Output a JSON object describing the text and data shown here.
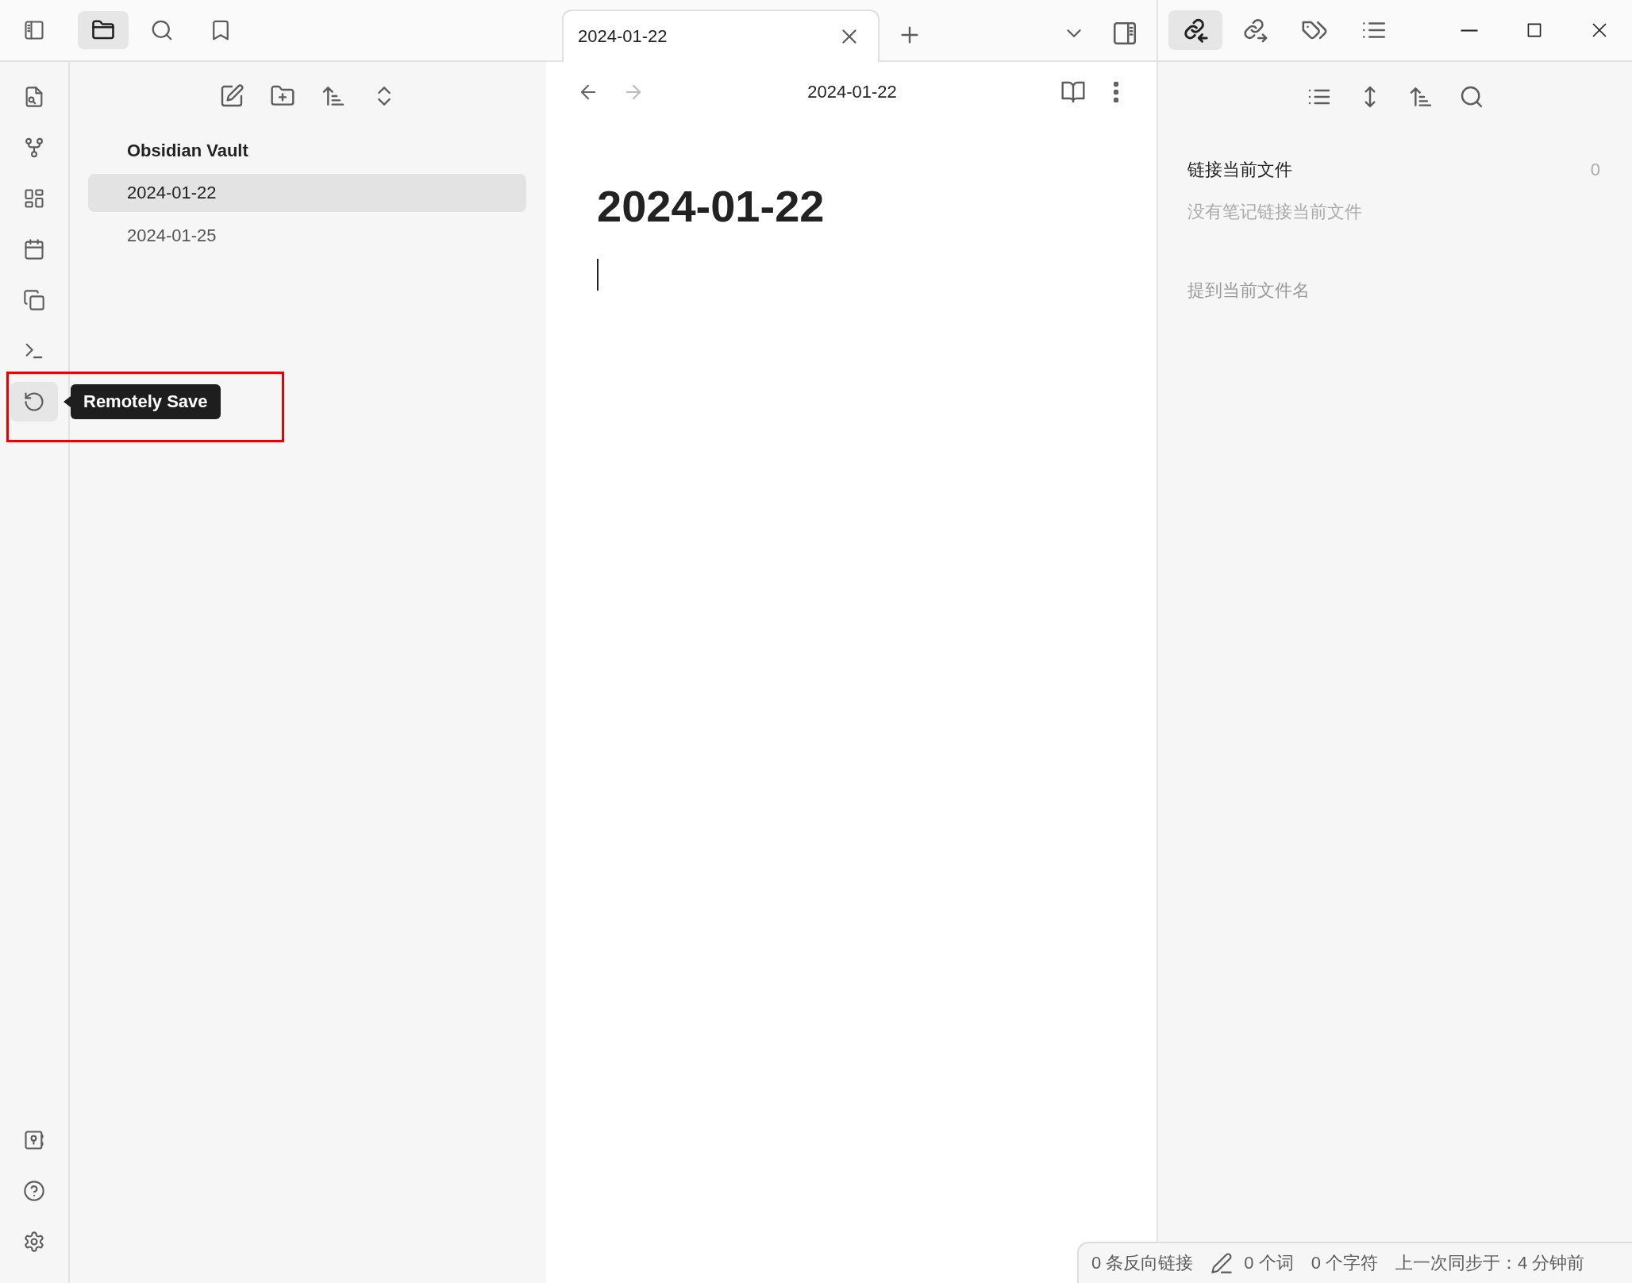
{
  "sidebar_tabs": [
    {
      "selected": true
    },
    {
      "selected": false
    },
    {
      "selected": false
    }
  ],
  "ribbon": {
    "top": [
      {
        "hovered": false
      },
      {
        "hovered": false
      },
      {
        "hovered": false
      },
      {
        "hovered": false
      },
      {
        "hovered": false
      },
      {
        "hovered": false
      },
      {
        "hovered": true
      }
    ],
    "bottom": [
      {
        "hovered": false
      },
      {
        "hovered": false
      },
      {
        "hovered": false
      }
    ]
  },
  "tooltip": {
    "text": "Remotely Save"
  },
  "file_explorer": {
    "vault_name": "Obsidian Vault",
    "files": [
      {
        "name": "2024-01-22",
        "selected": true
      },
      {
        "name": "2024-01-25",
        "selected": false
      }
    ]
  },
  "tabs": [
    {
      "title": "2024-01-22",
      "selected": true
    }
  ],
  "editor": {
    "back_disabled": false,
    "forward_disabled": true,
    "breadcrumb": "2024-01-22",
    "title": "2024-01-22"
  },
  "right_panel": {
    "tabs": [
      {
        "selected": true
      },
      {
        "selected": false
      },
      {
        "selected": false
      },
      {
        "selected": false
      }
    ],
    "linked_heading": "链接当前文件",
    "linked_count": "0",
    "linked_empty": "没有笔记链接当前文件",
    "unlinked_heading": "提到当前文件名"
  },
  "status_bar": {
    "backlinks": "0 条反向链接",
    "words": "0 个词",
    "characters": "0 个字符",
    "sync": "上一次同步于：4 分钟前"
  }
}
